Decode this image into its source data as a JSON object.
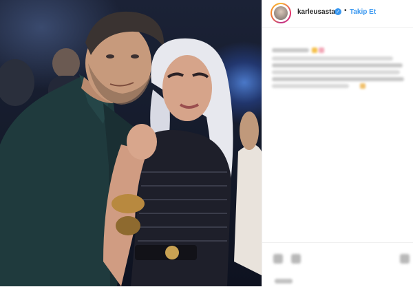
{
  "post": {
    "image": {
      "alt": "",
      "icon": "photo"
    },
    "header": {
      "username": "karleusastar",
      "verified_icon": "verified-badge-icon",
      "separator": "•",
      "follow_label": "Takip Et",
      "follow_color": "#3897f0"
    },
    "caption": {
      "blurred": true
    },
    "actions": {
      "blurred": true,
      "icons": [
        "heart-icon",
        "comment-icon",
        "bookmark-icon"
      ]
    }
  }
}
